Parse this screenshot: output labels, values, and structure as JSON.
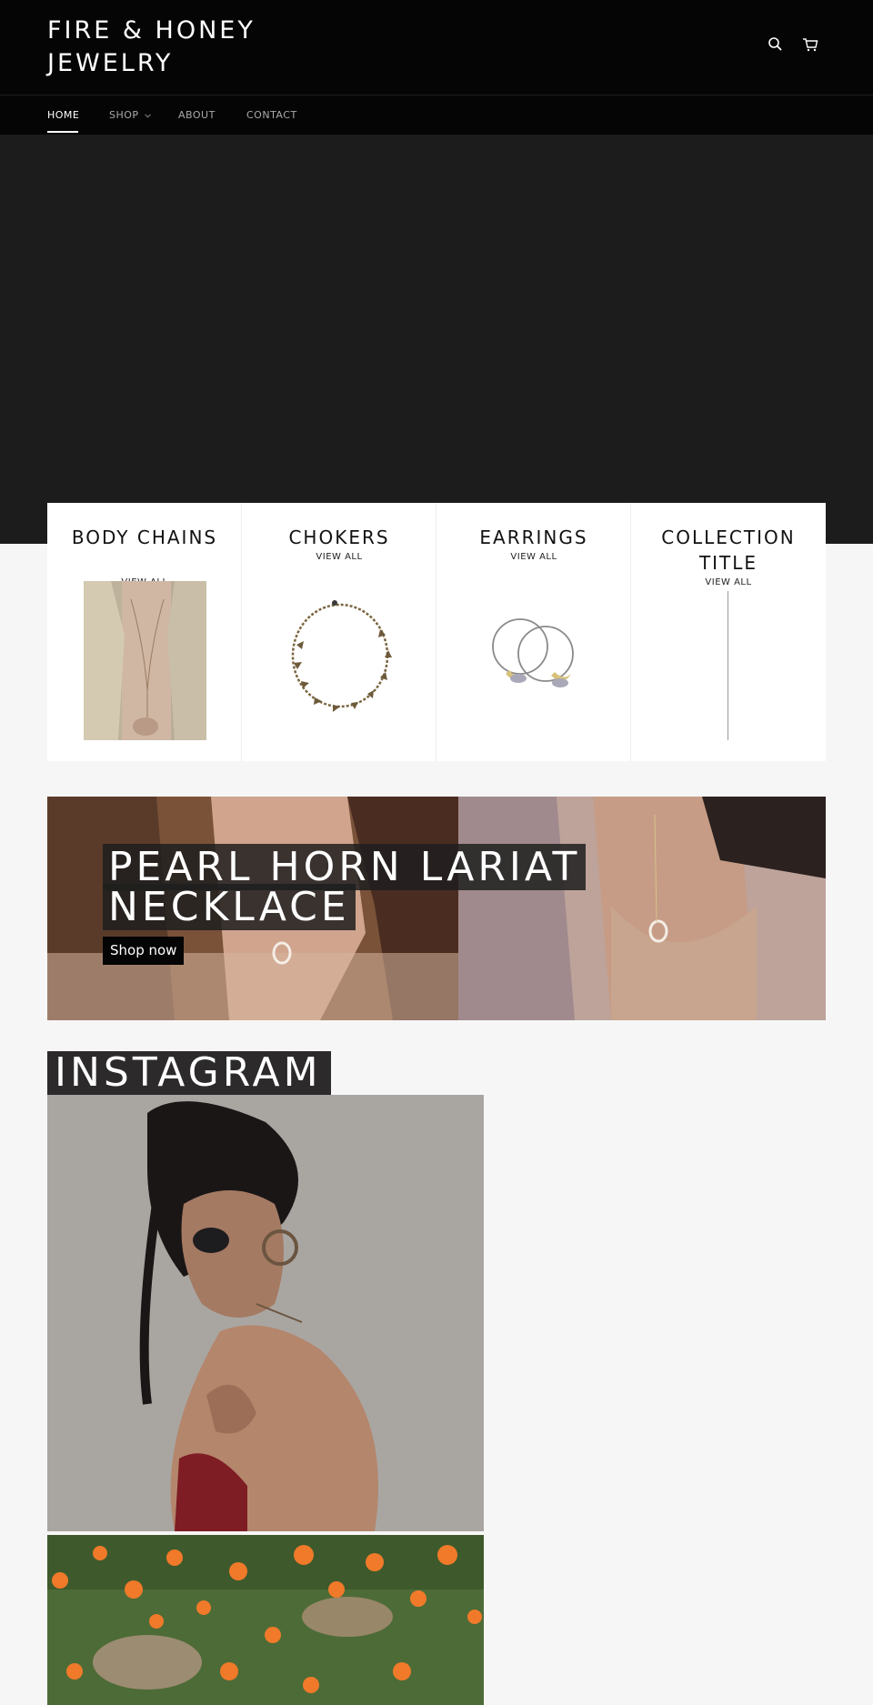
{
  "header": {
    "logo": "FIRE & HONEY JEWELRY",
    "search_icon": "search-icon",
    "cart_icon": "cart-icon"
  },
  "nav": {
    "items": [
      {
        "label": "HOME",
        "active": true
      },
      {
        "label": "SHOP",
        "has_dropdown": true
      },
      {
        "label": "ABOUT"
      },
      {
        "label": "CONTACT"
      }
    ]
  },
  "collections": [
    {
      "title": "BODY CHAINS",
      "link": "VIEW ALL"
    },
    {
      "title": "CHOKERS",
      "link": "VIEW ALL"
    },
    {
      "title": "EARRINGS",
      "link": "VIEW ALL"
    },
    {
      "title": "COLLECTION TITLE",
      "link": "VIEW ALL"
    }
  ],
  "promo": {
    "title_line1": "PEARL HORN LARIAT",
    "title_line2": "NECKLACE",
    "button": "Shop now"
  },
  "instagram": {
    "title": "INSTAGRAM"
  },
  "colors": {
    "header_bg": "#050505",
    "hero_bg": "#1c1c1d",
    "page_bg": "#f6f6f6"
  }
}
